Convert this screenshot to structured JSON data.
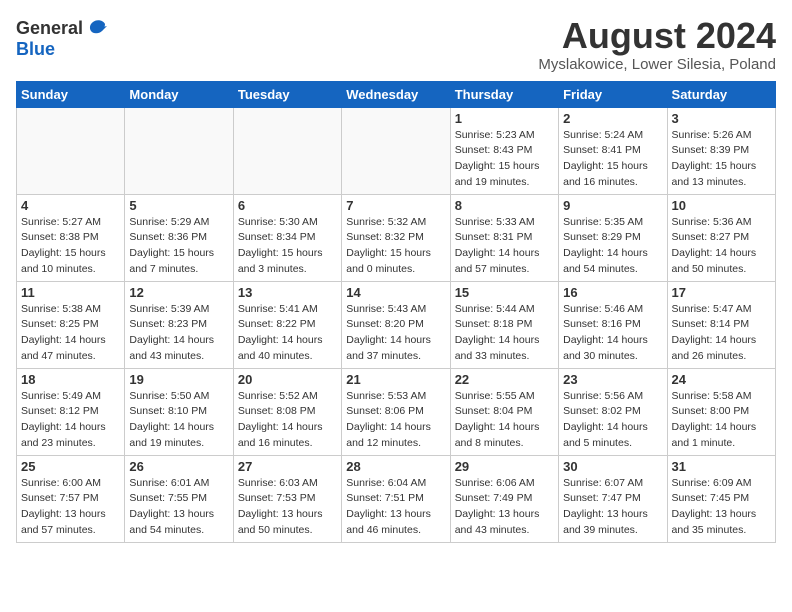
{
  "header": {
    "logo_general": "General",
    "logo_blue": "Blue",
    "main_title": "August 2024",
    "subtitle": "Myslakowice, Lower Silesia, Poland"
  },
  "calendar": {
    "days_of_week": [
      "Sunday",
      "Monday",
      "Tuesday",
      "Wednesday",
      "Thursday",
      "Friday",
      "Saturday"
    ],
    "weeks": [
      [
        {
          "day": "",
          "info": ""
        },
        {
          "day": "",
          "info": ""
        },
        {
          "day": "",
          "info": ""
        },
        {
          "day": "",
          "info": ""
        },
        {
          "day": "1",
          "info": "Sunrise: 5:23 AM\nSunset: 8:43 PM\nDaylight: 15 hours\nand 19 minutes."
        },
        {
          "day": "2",
          "info": "Sunrise: 5:24 AM\nSunset: 8:41 PM\nDaylight: 15 hours\nand 16 minutes."
        },
        {
          "day": "3",
          "info": "Sunrise: 5:26 AM\nSunset: 8:39 PM\nDaylight: 15 hours\nand 13 minutes."
        }
      ],
      [
        {
          "day": "4",
          "info": "Sunrise: 5:27 AM\nSunset: 8:38 PM\nDaylight: 15 hours\nand 10 minutes."
        },
        {
          "day": "5",
          "info": "Sunrise: 5:29 AM\nSunset: 8:36 PM\nDaylight: 15 hours\nand 7 minutes."
        },
        {
          "day": "6",
          "info": "Sunrise: 5:30 AM\nSunset: 8:34 PM\nDaylight: 15 hours\nand 3 minutes."
        },
        {
          "day": "7",
          "info": "Sunrise: 5:32 AM\nSunset: 8:32 PM\nDaylight: 15 hours\nand 0 minutes."
        },
        {
          "day": "8",
          "info": "Sunrise: 5:33 AM\nSunset: 8:31 PM\nDaylight: 14 hours\nand 57 minutes."
        },
        {
          "day": "9",
          "info": "Sunrise: 5:35 AM\nSunset: 8:29 PM\nDaylight: 14 hours\nand 54 minutes."
        },
        {
          "day": "10",
          "info": "Sunrise: 5:36 AM\nSunset: 8:27 PM\nDaylight: 14 hours\nand 50 minutes."
        }
      ],
      [
        {
          "day": "11",
          "info": "Sunrise: 5:38 AM\nSunset: 8:25 PM\nDaylight: 14 hours\nand 47 minutes."
        },
        {
          "day": "12",
          "info": "Sunrise: 5:39 AM\nSunset: 8:23 PM\nDaylight: 14 hours\nand 43 minutes."
        },
        {
          "day": "13",
          "info": "Sunrise: 5:41 AM\nSunset: 8:22 PM\nDaylight: 14 hours\nand 40 minutes."
        },
        {
          "day": "14",
          "info": "Sunrise: 5:43 AM\nSunset: 8:20 PM\nDaylight: 14 hours\nand 37 minutes."
        },
        {
          "day": "15",
          "info": "Sunrise: 5:44 AM\nSunset: 8:18 PM\nDaylight: 14 hours\nand 33 minutes."
        },
        {
          "day": "16",
          "info": "Sunrise: 5:46 AM\nSunset: 8:16 PM\nDaylight: 14 hours\nand 30 minutes."
        },
        {
          "day": "17",
          "info": "Sunrise: 5:47 AM\nSunset: 8:14 PM\nDaylight: 14 hours\nand 26 minutes."
        }
      ],
      [
        {
          "day": "18",
          "info": "Sunrise: 5:49 AM\nSunset: 8:12 PM\nDaylight: 14 hours\nand 23 minutes."
        },
        {
          "day": "19",
          "info": "Sunrise: 5:50 AM\nSunset: 8:10 PM\nDaylight: 14 hours\nand 19 minutes."
        },
        {
          "day": "20",
          "info": "Sunrise: 5:52 AM\nSunset: 8:08 PM\nDaylight: 14 hours\nand 16 minutes."
        },
        {
          "day": "21",
          "info": "Sunrise: 5:53 AM\nSunset: 8:06 PM\nDaylight: 14 hours\nand 12 minutes."
        },
        {
          "day": "22",
          "info": "Sunrise: 5:55 AM\nSunset: 8:04 PM\nDaylight: 14 hours\nand 8 minutes."
        },
        {
          "day": "23",
          "info": "Sunrise: 5:56 AM\nSunset: 8:02 PM\nDaylight: 14 hours\nand 5 minutes."
        },
        {
          "day": "24",
          "info": "Sunrise: 5:58 AM\nSunset: 8:00 PM\nDaylight: 14 hours\nand 1 minute."
        }
      ],
      [
        {
          "day": "25",
          "info": "Sunrise: 6:00 AM\nSunset: 7:57 PM\nDaylight: 13 hours\nand 57 minutes."
        },
        {
          "day": "26",
          "info": "Sunrise: 6:01 AM\nSunset: 7:55 PM\nDaylight: 13 hours\nand 54 minutes."
        },
        {
          "day": "27",
          "info": "Sunrise: 6:03 AM\nSunset: 7:53 PM\nDaylight: 13 hours\nand 50 minutes."
        },
        {
          "day": "28",
          "info": "Sunrise: 6:04 AM\nSunset: 7:51 PM\nDaylight: 13 hours\nand 46 minutes."
        },
        {
          "day": "29",
          "info": "Sunrise: 6:06 AM\nSunset: 7:49 PM\nDaylight: 13 hours\nand 43 minutes."
        },
        {
          "day": "30",
          "info": "Sunrise: 6:07 AM\nSunset: 7:47 PM\nDaylight: 13 hours\nand 39 minutes."
        },
        {
          "day": "31",
          "info": "Sunrise: 6:09 AM\nSunset: 7:45 PM\nDaylight: 13 hours\nand 35 minutes."
        }
      ]
    ]
  }
}
